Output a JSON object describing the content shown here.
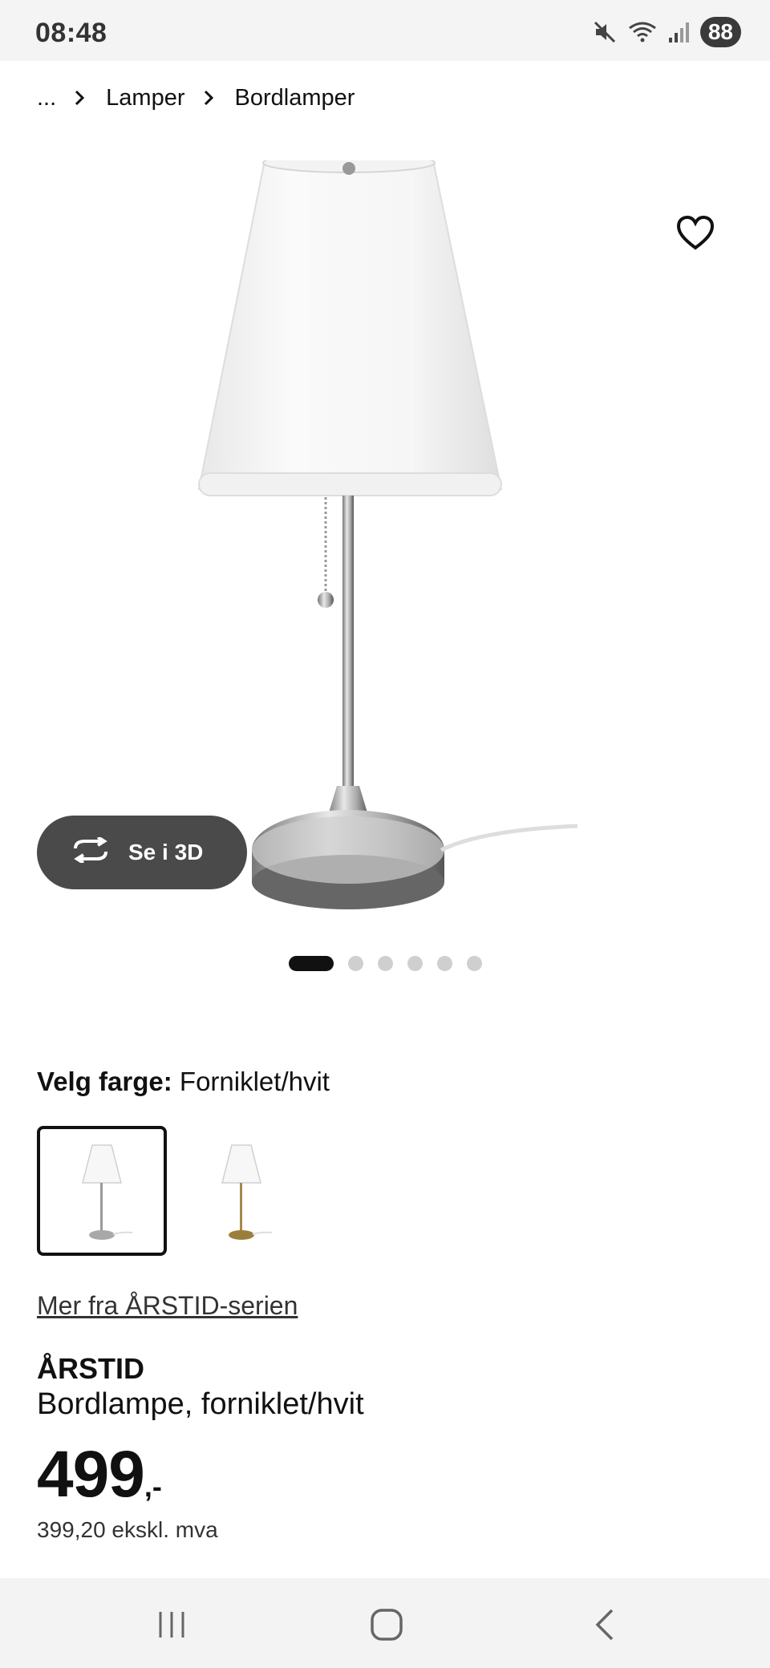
{
  "status_bar": {
    "time": "08:48",
    "battery": "88",
    "icons": [
      "mute-icon",
      "wifi-icon",
      "signal-icon"
    ]
  },
  "breadcrumb": {
    "items": [
      "...",
      "Lamper",
      "Bordlamper"
    ]
  },
  "product_image": {
    "view_3d_label": "Se i 3D",
    "carousel_count": 6,
    "carousel_active": 1
  },
  "color": {
    "label": "Velg farge:",
    "value": "Forniklet/hvit",
    "options": [
      "Forniklet/hvit",
      "Messing/hvit"
    ]
  },
  "series_link": "Mer fra ÅRSTID-serien",
  "product": {
    "name": "ÅRSTID",
    "description": "Bordlampe, forniklet/hvit",
    "price": "499",
    "price_suffix": ",-",
    "price_ex_vat": "399,20 ekskl. mva"
  },
  "colors": {
    "accent_dark": "#111111",
    "button_bg": "#4a4a4a",
    "dot_inactive": "#cfcfcf"
  }
}
